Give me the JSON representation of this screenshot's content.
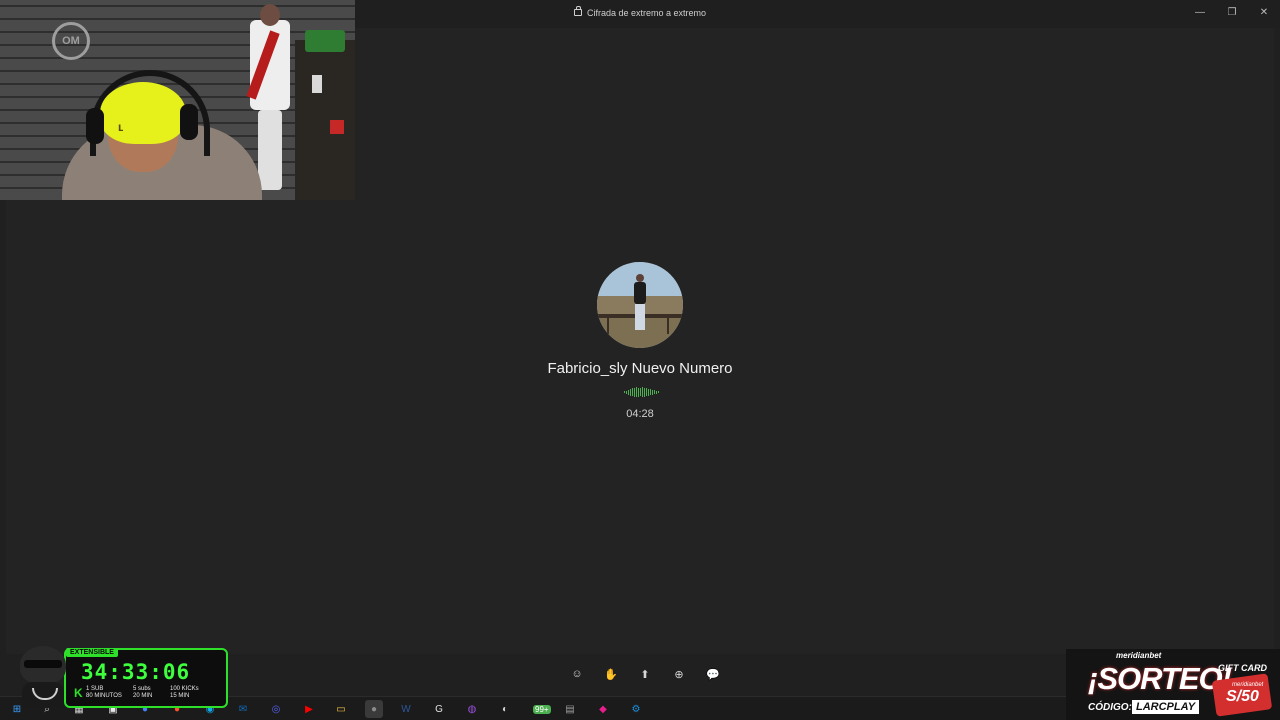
{
  "window": {
    "title": "Cifrada de extremo a extremo",
    "controls": {
      "minimize": "—",
      "restore": "❐",
      "close": "✕"
    }
  },
  "call": {
    "contact_name": "Fabricio_sly Nuevo Numero",
    "duration": "04:28",
    "voice_indicator_color": "#4caf50",
    "controls": [
      {
        "name": "reactions-icon",
        "glyph": "☺"
      },
      {
        "name": "raise-hand-icon",
        "glyph": "✋"
      },
      {
        "name": "share-screen-icon",
        "glyph": "⬆"
      },
      {
        "name": "add-people-icon",
        "glyph": "⊕"
      },
      {
        "name": "chat-icon",
        "glyph": "💬"
      }
    ]
  },
  "webcam": {
    "logo_text": "OM"
  },
  "timer_overlay": {
    "tag": "EXTENSIBLE",
    "time": "34:33:06",
    "k_label": "K",
    "sub_label": "1 SUB",
    "sub_value": "80 MINUTOS",
    "gift_label": "5 subs",
    "gift_value": "20 MIN",
    "kicks_label": "100 KICKs",
    "kicks_value": "15 MIN",
    "accent": "#2fe02a"
  },
  "promo": {
    "brand": "meridianbet",
    "title": "¡SORTEO!",
    "code_label": "CÓDIGO:",
    "code": "LARCPLAY",
    "gift_label": "GIFT CARD",
    "gift_brand": "meridianbet",
    "gift_amount": "S/50"
  },
  "taskbar": {
    "badge": "99+",
    "icons": [
      "windows-start-icon",
      "search-icon",
      "task-view-icon",
      "store-icon",
      "chrome-icon",
      "brave-icon",
      "edge-icon",
      "outlook-icon",
      "discord-icon",
      "youtube-icon",
      "file-explorer-icon",
      "obs-icon",
      "word-icon",
      "logitech-icon",
      "messenger-icon",
      "app-icon",
      "xbox-icon",
      "calculator-icon",
      "kick-icon",
      "steam-icon"
    ]
  }
}
